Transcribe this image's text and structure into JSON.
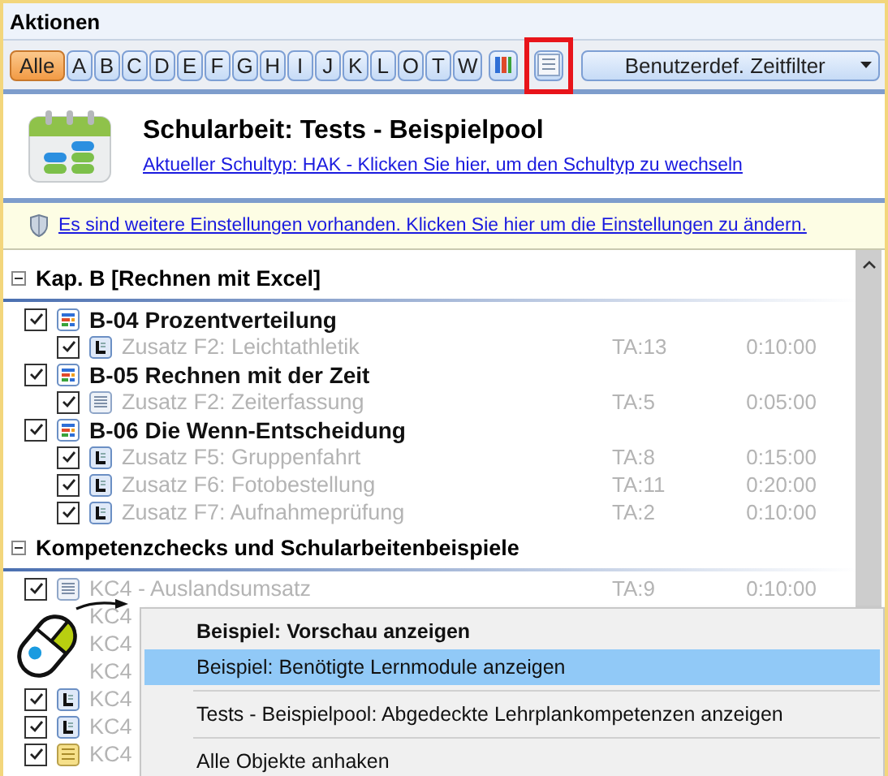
{
  "header": {
    "title": "Aktionen"
  },
  "filter_buttons": [
    {
      "label": "Alle",
      "selected": true
    },
    {
      "label": "A",
      "selected": false
    },
    {
      "label": "B",
      "selected": false
    },
    {
      "label": "C",
      "selected": false
    },
    {
      "label": "D",
      "selected": false
    },
    {
      "label": "E",
      "selected": false
    },
    {
      "label": "F",
      "selected": false
    },
    {
      "label": "G",
      "selected": false
    },
    {
      "label": "H",
      "selected": false
    },
    {
      "label": "I",
      "selected": false
    },
    {
      "label": "J",
      "selected": false
    },
    {
      "label": "K",
      "selected": false
    },
    {
      "label": "L",
      "selected": false
    },
    {
      "label": "O",
      "selected": false
    },
    {
      "label": "T",
      "selected": false
    },
    {
      "label": "W",
      "selected": false
    }
  ],
  "view_buttons": [
    {
      "kind": "chart",
      "annotated": false
    },
    {
      "kind": "list",
      "annotated": true
    }
  ],
  "time_filter": {
    "value": "Benutzerdef. Zeitfilter"
  },
  "title_panel": {
    "title": "Schularbeit: Tests - Beispielpool",
    "link": "Aktueller Schultyp: HAK - Klicken Sie hier, um den Schultyp zu wechseln"
  },
  "notice": {
    "link": "Es sind weitere Einstellungen vorhanden. Klicken Sie hier um die Einstellungen zu ändern."
  },
  "tree": [
    {
      "label": "Kap. B [Rechnen mit Excel]",
      "expanded": true,
      "children": [
        {
          "label": "B-04 Prozentverteilung",
          "checked": true,
          "kind": "chart",
          "children": [
            {
              "label": "Zusatz F2: Leichtathletik",
              "checked": true,
              "kind": "letter",
              "ta": "TA:13",
              "time": "0:10:00"
            }
          ]
        },
        {
          "label": "B-05 Rechnen mit der Zeit",
          "checked": true,
          "kind": "chart",
          "children": [
            {
              "label": "Zusatz F2: Zeiterfassung",
              "checked": true,
              "kind": "list",
              "ta": "TA:5",
              "time": "0:05:00"
            }
          ]
        },
        {
          "label": "B-06 Die Wenn-Entscheidung",
          "checked": true,
          "kind": "chart",
          "children": [
            {
              "label": "Zusatz F5: Gruppenfahrt",
              "checked": true,
              "kind": "letter",
              "ta": "TA:8",
              "time": "0:15:00"
            },
            {
              "label": "Zusatz F6: Fotobestellung",
              "checked": true,
              "kind": "letter",
              "ta": "TA:11",
              "time": "0:20:00"
            },
            {
              "label": "Zusatz F7: Aufnahmeprüfung",
              "checked": true,
              "kind": "letter",
              "ta": "TA:2",
              "time": "0:10:00"
            }
          ]
        }
      ]
    },
    {
      "label": "Kompetenzchecks und Schularbeitenbeispiele",
      "expanded": true,
      "children": [
        {
          "label": "KC4 - Auslandsumsatz",
          "checked": true,
          "kind": "list",
          "ta": "TA:9",
          "time": "0:10:00"
        },
        {
          "label": "KC4"
        },
        {
          "label": "KC4"
        },
        {
          "label": "KC4"
        },
        {
          "label": "KC4",
          "checked": true,
          "kind": "letter"
        },
        {
          "label": "KC4",
          "checked": true,
          "kind": "letter"
        },
        {
          "label": "KC4",
          "checked": true,
          "kind": "yellow"
        }
      ]
    }
  ],
  "context_menu": {
    "items": [
      {
        "kind": "default",
        "label": "Beispiel: Vorschau anzeigen",
        "selected": false
      },
      {
        "kind": "item",
        "label": "Beispiel: Benötigte Lernmodule anzeigen",
        "selected": true
      },
      {
        "kind": "separator"
      },
      {
        "kind": "item",
        "label": "Tests - Beispielpool: Abgedeckte Lehrplankompetenzen anzeigen",
        "selected": false
      },
      {
        "kind": "separator"
      },
      {
        "kind": "item",
        "label": "Alle Objekte anhaken",
        "selected": false
      }
    ]
  }
}
